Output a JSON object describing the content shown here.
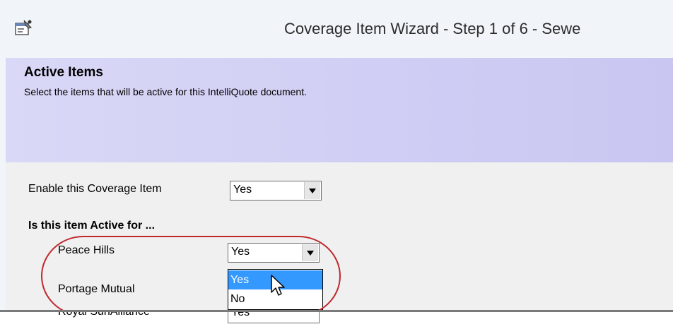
{
  "window": {
    "title": "Coverage Item Wizard - Step 1 of 6 - Sewe",
    "icon": "properties-window-icon"
  },
  "banner": {
    "title": "Active Items",
    "subtitle": "Select the items that will be active for this IntelliQuote document."
  },
  "form": {
    "enable_label": "Enable this Coverage Item",
    "enable_value": "Yes",
    "active_for_heading": "Is this item Active for ...",
    "insurers": [
      {
        "label": "Peace Hills",
        "value": "Yes"
      },
      {
        "label": "Portage Mutual",
        "value": ""
      },
      {
        "label": "Royal SunAlliance",
        "value": "Yes"
      }
    ]
  },
  "dropdown": {
    "options": [
      "Yes",
      "No"
    ],
    "highlighted": "Yes"
  },
  "colors": {
    "highlight": "#3399ff",
    "annotation": "#c0282e",
    "banner": "#d9d8f6"
  }
}
